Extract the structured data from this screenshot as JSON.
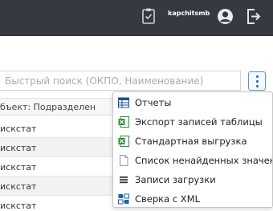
{
  "topbar": {
    "username": "kapchitsmb",
    "icons": [
      "clipboard-check-icon",
      "user-avatar-icon",
      "logout-icon"
    ]
  },
  "search": {
    "placeholder": "Быстрый поиск (ОКПО, Наименование)",
    "value": ""
  },
  "table": {
    "column_header": "бъект: Подразделен",
    "rows": [
      "искстат",
      "искстат",
      "искстат",
      "искстат",
      "искстат"
    ]
  },
  "menu": {
    "items": [
      {
        "label": "Отчеты",
        "icon": "table-grid-icon"
      },
      {
        "label": "Экспорт записей таблицы",
        "icon": "excel-icon"
      },
      {
        "label": "Стандартная выгрузка",
        "icon": "excel-icon"
      },
      {
        "label": "Список ненайденных значени",
        "icon": "blank-document-icon"
      },
      {
        "label": "Записи загрузки",
        "icon": "list-lines-icon"
      },
      {
        "label": "Сверка с XML",
        "icon": "xml-compare-icon"
      }
    ]
  },
  "colors": {
    "topbar_bg": "#343a40",
    "accent": "#1f64a9",
    "excel_green": "#2e8b3a"
  }
}
